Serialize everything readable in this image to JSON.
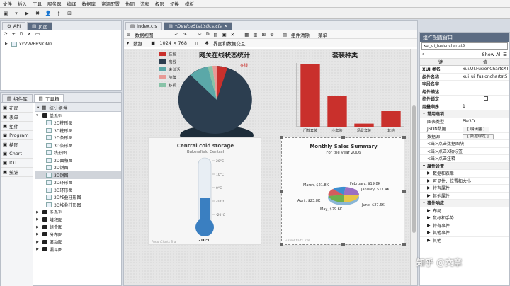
{
  "menu": [
    "文件",
    "插入",
    "工具",
    "服务器",
    "编译",
    "数据库",
    "资源配置",
    "协同",
    "流程",
    "权限",
    "切换",
    "模板"
  ],
  "toolbar_icons": [
    "save-icon",
    "separator",
    "run-icon",
    "stop-icon",
    "separator",
    "user-icon",
    "function-icon",
    "tool-icon"
  ],
  "left_top": {
    "tabs": [
      "API",
      "页面"
    ],
    "tree_root": "xxVVVERSION0"
  },
  "left_bottom": {
    "tabs": [
      "组件库",
      "工具箱"
    ],
    "side_buttons": [
      "布局",
      "表单",
      "组件",
      "Program",
      "绘图",
      "Chart",
      "IOT",
      "统计"
    ],
    "header": "统计组件",
    "tree_group": "单系列",
    "tree_items": [
      "2D柱形图",
      "3D柱形图",
      "2D条形图",
      "3D条形图",
      "线形图",
      "2D面积图",
      "2D饼图",
      "3D饼图",
      "2D环形图",
      "3D环形图",
      "2D堆叠柱形图",
      "3D堆叠柱形图"
    ],
    "selected_item": "3D饼图",
    "tree_groups_more": [
      "多系列",
      "堆积图",
      "组合图",
      "分布图",
      "滚动图",
      "漏斗图"
    ]
  },
  "editor": {
    "tabs": [
      "index.cls",
      "*DeviceStatistics.cls"
    ],
    "toolbar": {
      "view_label": "数据视图",
      "resolution": "1024 × 768",
      "interaction": "界面和数据交互",
      "datasource_label": "数据",
      "component_clear": "组件清除",
      "more": "菜单"
    }
  },
  "charts": {
    "pie": {
      "title": "网关在线状态统计",
      "legend": [
        "在线",
        "离线",
        "未激活",
        "故障",
        "移机"
      ],
      "colors": [
        "#c9302c",
        "#2c3e50",
        "#5ba8a8",
        "#e89a96",
        "#88c3a8"
      ],
      "slice_labels": [
        "离线",
        "在线"
      ]
    },
    "bar": {
      "title": "套装种类",
      "categories": [
        "门款套装",
        "小套装",
        "场景套装",
        "其他"
      ],
      "values": [
        20,
        10,
        1,
        5
      ],
      "ylim": [
        0,
        20
      ],
      "color": "#c9302c"
    },
    "thermo": {
      "title": "Central cold storage",
      "subtitle": "Bakersfield Central",
      "ticks": [
        "20°C",
        "10°C",
        "0°C",
        "-10°C",
        "-20°C"
      ],
      "value_label": "-10°C",
      "watermark": "FusionCharts Trial"
    },
    "sales": {
      "title": "Monthly Sales Summary",
      "subtitle": "For the year 2006",
      "labels": [
        "February, $19.8K",
        "January, $17.4K",
        "June, $27.6K",
        "May, $29.6K",
        "April, $23.8K",
        "March, $21.8K"
      ],
      "watermark": "FusionCharts Trial"
    }
  },
  "right": {
    "title": "组件配置窗口",
    "selected": "xui_ui_fusionchartst5",
    "show_all": "Show All",
    "col_key": "键",
    "col_val": "值",
    "rows": [
      {
        "k": "XUI 类名",
        "v": "xui.UI.FusionChartsXT"
      },
      {
        "k": "组件名称",
        "v": "xui_ui_fusionchartst5"
      },
      {
        "k": "字段名字",
        "v": ""
      },
      {
        "k": "组件描述",
        "v": ""
      },
      {
        "k": "控件锁定",
        "v": "checkbox"
      },
      {
        "k": "层叠顺序",
        "v": "1"
      }
    ],
    "sections": [
      {
        "label": "常用选项",
        "kind": "group"
      },
      {
        "label": "图表类型",
        "v": "Pie3D",
        "kind": "prop"
      },
      {
        "label": "JSON数据",
        "v": "[ 编辑器 ]",
        "kind": "prop"
      },
      {
        "label": "数据源",
        "v": "[ 数据绑定 ]",
        "kind": "prop"
      },
      {
        "label": "<当>点击数据图块",
        "kind": "sub"
      },
      {
        "label": "<当>点击X轴标签",
        "kind": "sub"
      },
      {
        "label": "<当>点击注释",
        "kind": "sub"
      },
      {
        "label": "属性设置",
        "kind": "group"
      },
      {
        "label": "数据和表单",
        "kind": "sub2"
      },
      {
        "label": "可见性、位置和大小",
        "kind": "sub2"
      },
      {
        "label": "特有属性",
        "kind": "sub2"
      },
      {
        "label": "其他属性",
        "kind": "sub2"
      },
      {
        "label": "事件响应",
        "kind": "group"
      },
      {
        "label": "布局",
        "kind": "sub2"
      },
      {
        "label": "鼠标和手势",
        "kind": "sub2"
      },
      {
        "label": "特有事件",
        "kind": "sub2"
      },
      {
        "label": "其他事件",
        "kind": "sub2"
      },
      {
        "label": "其他",
        "kind": "sub2"
      }
    ],
    "watermark": "知乎 @文章"
  }
}
